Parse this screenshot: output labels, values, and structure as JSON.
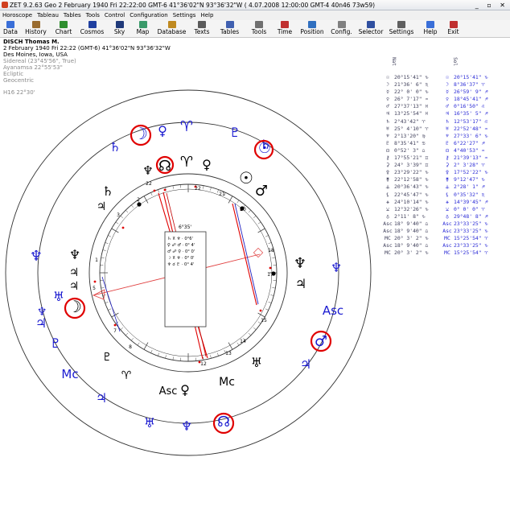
{
  "window": {
    "title": "ZET 9.2.63 Geo    2 February 1940   Fri  22:22:00 GMT-6 41°36'02\"N  93°36'32\"W   ( 4.07.2008  12:00:00 GMT-4 40n46 73w59)",
    "controls": "_ ▫ ✕"
  },
  "menu": [
    "Horoscope",
    "Tableau",
    "Tables",
    "Tools",
    "Control",
    "Configuration",
    "Settings",
    "Help"
  ],
  "toolbar": [
    {
      "label": "Data",
      "color": "#3a6fd8"
    },
    {
      "label": "History",
      "color": "#9a6c2f"
    },
    {
      "label": "Chart",
      "color": "#2f8f2f"
    },
    {
      "label": "Cosmos",
      "color": "#2040a0"
    },
    {
      "label": "Sky",
      "color": "#203a7a"
    },
    {
      "label": "Map",
      "color": "#3a9a6a"
    },
    {
      "label": "Database",
      "color": "#c08a20"
    },
    {
      "label": "Texts",
      "color": "#5a5a5a"
    },
    {
      "label": "Tables",
      "color": "#4060b0"
    },
    {
      "label": "Tools",
      "color": "#707070"
    },
    {
      "label": "Time",
      "color": "#c03030"
    },
    {
      "label": "Position",
      "color": "#3070c0"
    },
    {
      "label": "Config.",
      "color": "#808080"
    },
    {
      "label": "Selector",
      "color": "#3050a0"
    },
    {
      "label": "Settings",
      "color": "#606060"
    },
    {
      "label": "Help",
      "color": "#3a6fd8"
    },
    {
      "label": "Exit",
      "color": "#c03030"
    }
  ],
  "header": {
    "name": "DISCH Thomas M.",
    "datetime": "2 February 1940   Fri   22:22 (GMT-6) 41°36'02\"N  93°36'32\"W",
    "place": "Des Moines, Iowa, USA",
    "lines_dim": [
      "Sidereal (23°45'56\", True)",
      "Ayanamsa 22°55'53\"",
      "Ecliptic",
      "Geocentric"
    ],
    "house": "H16  22°30'"
  },
  "table": {
    "col_nat": "Nat",
    "col_sol": "Sol",
    "rows": [
      {
        "g1": "☉",
        "v1": "20°15'41\" ♑",
        "g2": "☉",
        "v2": "20°15'41\" ♑"
      },
      {
        "g1": "☽",
        "v1": "21°36' 6\" ♏",
        "g2": "☽",
        "v2": "8°36'37\" ♈"
      },
      {
        "g1": "☿",
        "v1": "22° 0' 0\" ♑",
        "g2": "☿",
        "v2": "26°59' 9\" ♐"
      },
      {
        "g1": "♀",
        "v1": "26° 7'17\" ♒",
        "g2": "♀",
        "v2": "18°45'41\" ♐"
      },
      {
        "g1": "♂",
        "v1": "27°37'13\" ♓",
        "g2": "♂",
        "v2": "0°16'50\" ♌"
      },
      {
        "g1": "♃",
        "v1": "13°25'54\" ♓",
        "g2": "♃",
        "v2": "16°35' 5\" ♐"
      },
      {
        "g1": "♄",
        "v1": "2°43'42\" ♈",
        "g2": "♄",
        "v2": "12°53'17\" ♌"
      },
      {
        "g1": "♅",
        "v1": "25° 4'10\" ♈",
        "g2": "♅",
        "v2": "22°52'48\" ♒"
      },
      {
        "g1": "♆",
        "v1": "2°13'20\" ♍",
        "g2": "♆",
        "v2": "27°33' 6\" ♑"
      },
      {
        "g1": "♇",
        "v1": "8°35'41\" ♋",
        "g2": "♇",
        "v2": "6°22'27\" ♐"
      },
      {
        "g1": "☊",
        "v1": "0°52' 3\" ♎",
        "g2": "☊",
        "v2": "4°40'53\" ♒"
      },
      {
        "g1": "⚷",
        "v1": "17°55'21\" ♊",
        "g2": "⚷",
        "v2": "21°39'13\" ♒"
      },
      {
        "g1": "⚳",
        "v1": "24° 3'39\" ♊",
        "g2": "⚳",
        "v2": "2° 3'28\" ♈"
      },
      {
        "g1": "⚴",
        "v1": "23°29'22\" ♑",
        "g2": "⚴",
        "v2": "17°52'22\" ♑"
      },
      {
        "g1": "⚵",
        "v1": "22°12'58\" ♑",
        "g2": "⚵",
        "v2": "9°12'47\" ♑"
      },
      {
        "g1": "⚶",
        "v1": "20°36'43\" ♑",
        "g2": "⚶",
        "v2": "2°28' 1\" ♐"
      },
      {
        "g1": "⚸",
        "v1": "22°45'47\" ♑",
        "g2": "⚸",
        "v2": "0°35'32\" ♏"
      },
      {
        "g1": "⚹",
        "v1": "24°10'14\" ♑",
        "g2": "⚹",
        "v2": "14°39'45\" ♐"
      },
      {
        "g1": "⚺",
        "v1": "12°32'26\" ♑",
        "g2": "⚺",
        "v2": "0° 0' 0\" ♈"
      },
      {
        "g1": "♁",
        "v1": "2°11' 8\" ♑",
        "g2": "♁",
        "v2": "29°48' 8\" ♐"
      },
      {
        "g1": "Asc",
        "v1": "18° 9'40\" ♎",
        "g2": "Asc",
        "v2": "23°33'25\" ♑"
      },
      {
        "g1": "Asc",
        "v1": "18° 9'40\" ♎",
        "g2": "Asc",
        "v2": "23°33'25\" ♑"
      },
      {
        "g1": "MC",
        "v1": "20° 3' 2\" ♑",
        "g2": "MC",
        "v2": "15°25'54\" ♈"
      },
      {
        "g1": "Asc",
        "v1": "18° 9'40\" ♎",
        "g2": "Asc",
        "v2": "23°33'25\" ♑"
      },
      {
        "g1": "MC",
        "v1": "20° 3' 2\" ♑",
        "g2": "MC",
        "v2": "15°25'54\" ♈"
      }
    ]
  },
  "center_box": {
    "title": "6°35'",
    "lines": [
      "♄ ⊼ ♆ · 0°6'",
      "♀ ☍ ♂ · 0° 4'",
      "♂ ☍ ♀ · 0° 0'",
      "☽ ⊼ ♆ · 0° 0'",
      "♆ ☌ ♇ · 0° 4'"
    ]
  },
  "chart": {
    "inner_degree_labels": [
      "22",
      "22",
      "21",
      "20",
      "18",
      "17",
      "15",
      "14",
      "13",
      "12",
      "8",
      "7",
      "5",
      "3",
      "2",
      "1"
    ],
    "mc_label": "Mc",
    "asc_label": "Asc",
    "colors": {
      "red": "#e00000",
      "blue": "#1a1ad0",
      "black": "#000000",
      "highlight": "#e00000"
    },
    "inner_glyphs": [
      "♆",
      "♇",
      "♅",
      "☊",
      "♈",
      "♃",
      "♄",
      "☉",
      "♂",
      "♆",
      "♃",
      "☊",
      "♆",
      "♄",
      "♅",
      "☽",
      "♀",
      "♄",
      "♂",
      "☿",
      "♃",
      "♀",
      "♃",
      "♇"
    ],
    "outer_glyphs": [
      "☽",
      "♀",
      "♈",
      "♇",
      "♄",
      "☉",
      "♆",
      "♃",
      "♇",
      "♆",
      "♄",
      "♃",
      "♂",
      "♅",
      "♆",
      "♃",
      "♂",
      "♅",
      "☊",
      "♆",
      "♃",
      "♇"
    ],
    "outer_text": [
      "Asc",
      "Mc"
    ],
    "inner_text": [
      "Asc",
      "Mc"
    ]
  }
}
